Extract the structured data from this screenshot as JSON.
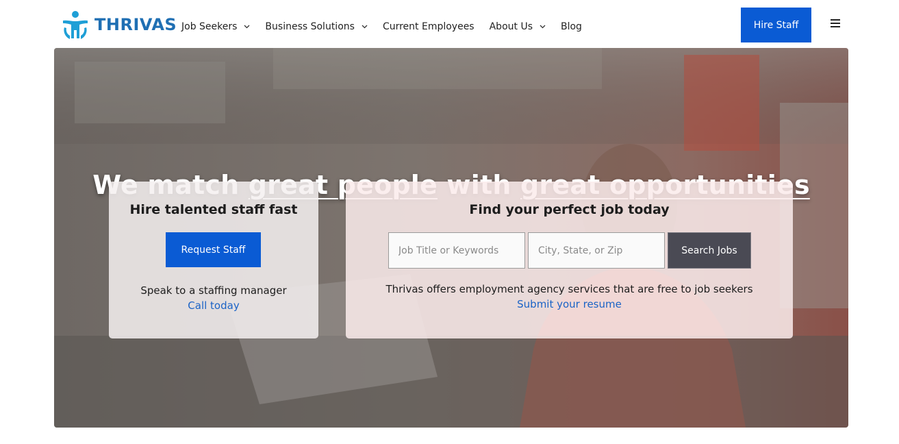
{
  "brand": {
    "name": "THRIVAS",
    "color": "#1f6fb3"
  },
  "nav": {
    "items": [
      {
        "label": "Job Seekers",
        "has_dropdown": true
      },
      {
        "label": "Business Solutions",
        "has_dropdown": true
      },
      {
        "label": "Current Employees",
        "has_dropdown": false
      },
      {
        "label": "About Us",
        "has_dropdown": true
      },
      {
        "label": "Blog",
        "has_dropdown": false
      }
    ],
    "hire_button": "Hire Staff",
    "menu_icon": "hamburger-icon"
  },
  "hero": {
    "title_part1": "We match ",
    "title_part2": "great people",
    "title_part3": " with ",
    "title_part4": "great opportunities",
    "hire_card": {
      "title": "Hire talented staff fast",
      "button": "Request Staff",
      "text": "Speak to a staffing manager",
      "link": "Call today"
    },
    "job_card": {
      "title": "Find your perfect job today",
      "keyword_placeholder": "Job Title or Keywords",
      "location_placeholder": "City, State, or Zip",
      "search_button": "Search Jobs",
      "text": "Thrivas offers employment agency services that are free to job seekers",
      "link": "Submit your resume"
    }
  },
  "colors": {
    "primary": "#0a5bd4",
    "link": "#1b63c6",
    "search_button": "#4a4a54"
  }
}
